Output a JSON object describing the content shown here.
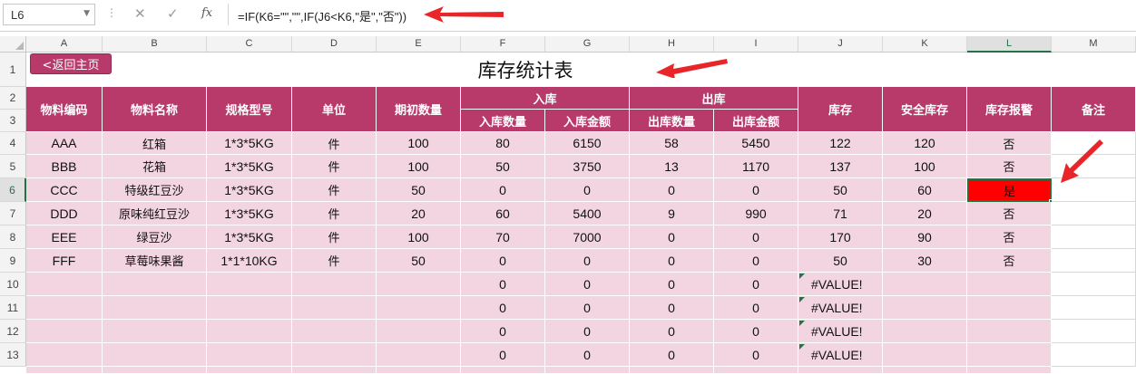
{
  "formula_bar": {
    "name_box": "L6",
    "formula": "=IF(K6=\"\",\"\",IF(J6<K6,\"是\",\"否\"))",
    "fx_label": "fx",
    "cancel_icon": "x-icon",
    "enter_icon": "check-icon"
  },
  "columns": [
    "A",
    "B",
    "C",
    "D",
    "E",
    "F",
    "G",
    "H",
    "I",
    "J",
    "K",
    "L",
    "M"
  ],
  "rows": [
    "1",
    "2",
    "3",
    "4",
    "5",
    "6",
    "7",
    "8",
    "9",
    "10",
    "11",
    "12",
    "13"
  ],
  "selected_cell": "L6",
  "title": "库存统计表",
  "back_button": "<返回主页",
  "headers": {
    "code": "物料编码",
    "name": "物料名称",
    "spec": "规格型号",
    "unit": "单位",
    "opening": "期初数量",
    "in_group": "入库",
    "in_qty": "入库数量",
    "in_amt": "入库金额",
    "out_group": "出库",
    "out_qty": "出库数量",
    "out_amt": "出库金额",
    "stock": "库存",
    "safety": "安全库存",
    "alarm": "库存报警",
    "remark": "备注"
  },
  "data_rows": [
    {
      "code": "AAA",
      "name": "红箱",
      "spec": "1*3*5KG",
      "unit": "件",
      "opening": "100",
      "in_qty": "80",
      "in_amt": "6150",
      "out_qty": "58",
      "out_amt": "5450",
      "stock": "122",
      "safety": "120",
      "alarm": "否"
    },
    {
      "code": "BBB",
      "name": "花箱",
      "spec": "1*3*5KG",
      "unit": "件",
      "opening": "100",
      "in_qty": "50",
      "in_amt": "3750",
      "out_qty": "13",
      "out_amt": "1170",
      "stock": "137",
      "safety": "100",
      "alarm": "否"
    },
    {
      "code": "CCC",
      "name": "特级红豆沙",
      "spec": "1*3*5KG",
      "unit": "件",
      "opening": "50",
      "in_qty": "0",
      "in_amt": "0",
      "out_qty": "0",
      "out_amt": "0",
      "stock": "50",
      "safety": "60",
      "alarm": "是"
    },
    {
      "code": "DDD",
      "name": "原味纯红豆沙",
      "spec": "1*3*5KG",
      "unit": "件",
      "opening": "20",
      "in_qty": "60",
      "in_amt": "5400",
      "out_qty": "9",
      "out_amt": "990",
      "stock": "71",
      "safety": "20",
      "alarm": "否"
    },
    {
      "code": "EEE",
      "name": "绿豆沙",
      "spec": "1*3*5KG",
      "unit": "件",
      "opening": "100",
      "in_qty": "70",
      "in_amt": "7000",
      "out_qty": "0",
      "out_amt": "0",
      "stock": "170",
      "safety": "90",
      "alarm": "否"
    },
    {
      "code": "FFF",
      "name": "草莓味果酱",
      "spec": "1*1*10KG",
      "unit": "件",
      "opening": "50",
      "in_qty": "0",
      "in_amt": "0",
      "out_qty": "0",
      "out_amt": "0",
      "stock": "50",
      "safety": "30",
      "alarm": "否"
    },
    {
      "code": "",
      "name": "",
      "spec": "",
      "unit": "",
      "opening": "",
      "in_qty": "0",
      "in_amt": "0",
      "out_qty": "0",
      "out_amt": "0",
      "stock": "#VALUE!",
      "safety": "",
      "alarm": ""
    },
    {
      "code": "",
      "name": "",
      "spec": "",
      "unit": "",
      "opening": "",
      "in_qty": "0",
      "in_amt": "0",
      "out_qty": "0",
      "out_amt": "0",
      "stock": "#VALUE!",
      "safety": "",
      "alarm": ""
    },
    {
      "code": "",
      "name": "",
      "spec": "",
      "unit": "",
      "opening": "",
      "in_qty": "0",
      "in_amt": "0",
      "out_qty": "0",
      "out_amt": "0",
      "stock": "#VALUE!",
      "safety": "",
      "alarm": ""
    },
    {
      "code": "",
      "name": "",
      "spec": "",
      "unit": "",
      "opening": "",
      "in_qty": "0",
      "in_amt": "0",
      "out_qty": "0",
      "out_amt": "0",
      "stock": "#VALUE!",
      "safety": "",
      "alarm": ""
    }
  ],
  "colors": {
    "header_bg": "#b83a6b",
    "body_bg": "#f2d5e0",
    "alarm_bg": "#ff0000",
    "selection": "#217346",
    "annotation_arrow": "#e8262a"
  }
}
